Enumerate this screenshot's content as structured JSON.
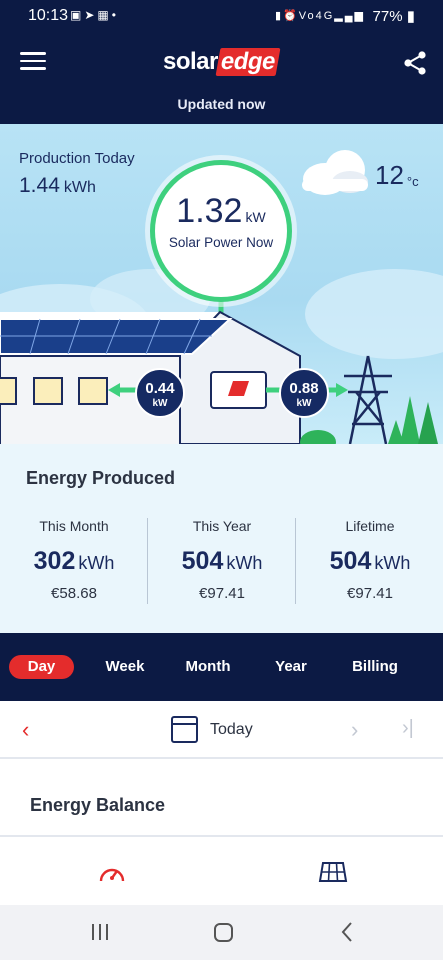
{
  "status_bar": {
    "time": "10:13",
    "left_icons": [
      "sms-icon",
      "telegram-icon",
      "gallery-icon",
      "dot-icon"
    ],
    "right_icons": [
      "battery-saver-icon",
      "alarm-icon",
      "volte-icon",
      "4g-icon",
      "signal-icon"
    ],
    "battery": "77%"
  },
  "header": {
    "logo_solar": "solar",
    "logo_edge": "edge",
    "updated_text": "Updated now"
  },
  "hero": {
    "production_label": "Production Today",
    "production_value": "1.44",
    "production_unit": "kWh",
    "temperature_value": "12",
    "temperature_unit": "°c",
    "power_value": "1.32",
    "power_unit": "kW",
    "power_label": "Solar Power Now",
    "consumption_value": "0.44",
    "consumption_unit": "kW",
    "grid_value": "0.88",
    "grid_unit": "kW"
  },
  "energy_produced": {
    "title": "Energy Produced",
    "stats": [
      {
        "label": "This Month",
        "value": "302",
        "unit": "kWh",
        "money": "€58.68"
      },
      {
        "label": "This Year",
        "value": "504",
        "unit": "kWh",
        "money": "€97.41"
      },
      {
        "label": "Lifetime",
        "value": "504",
        "unit": "kWh",
        "money": "€97.41"
      }
    ]
  },
  "period_tabs": {
    "items": [
      "Day",
      "Week",
      "Month",
      "Year",
      "Billing"
    ],
    "active": "Day"
  },
  "date_nav": {
    "label": "Today"
  },
  "energy_balance": {
    "title": "Energy Balance"
  },
  "colors": {
    "navy": "#0c1a44",
    "accent_red": "#e42c2c",
    "flow_green": "#3ed07e",
    "sky": "#b8e3f5"
  }
}
